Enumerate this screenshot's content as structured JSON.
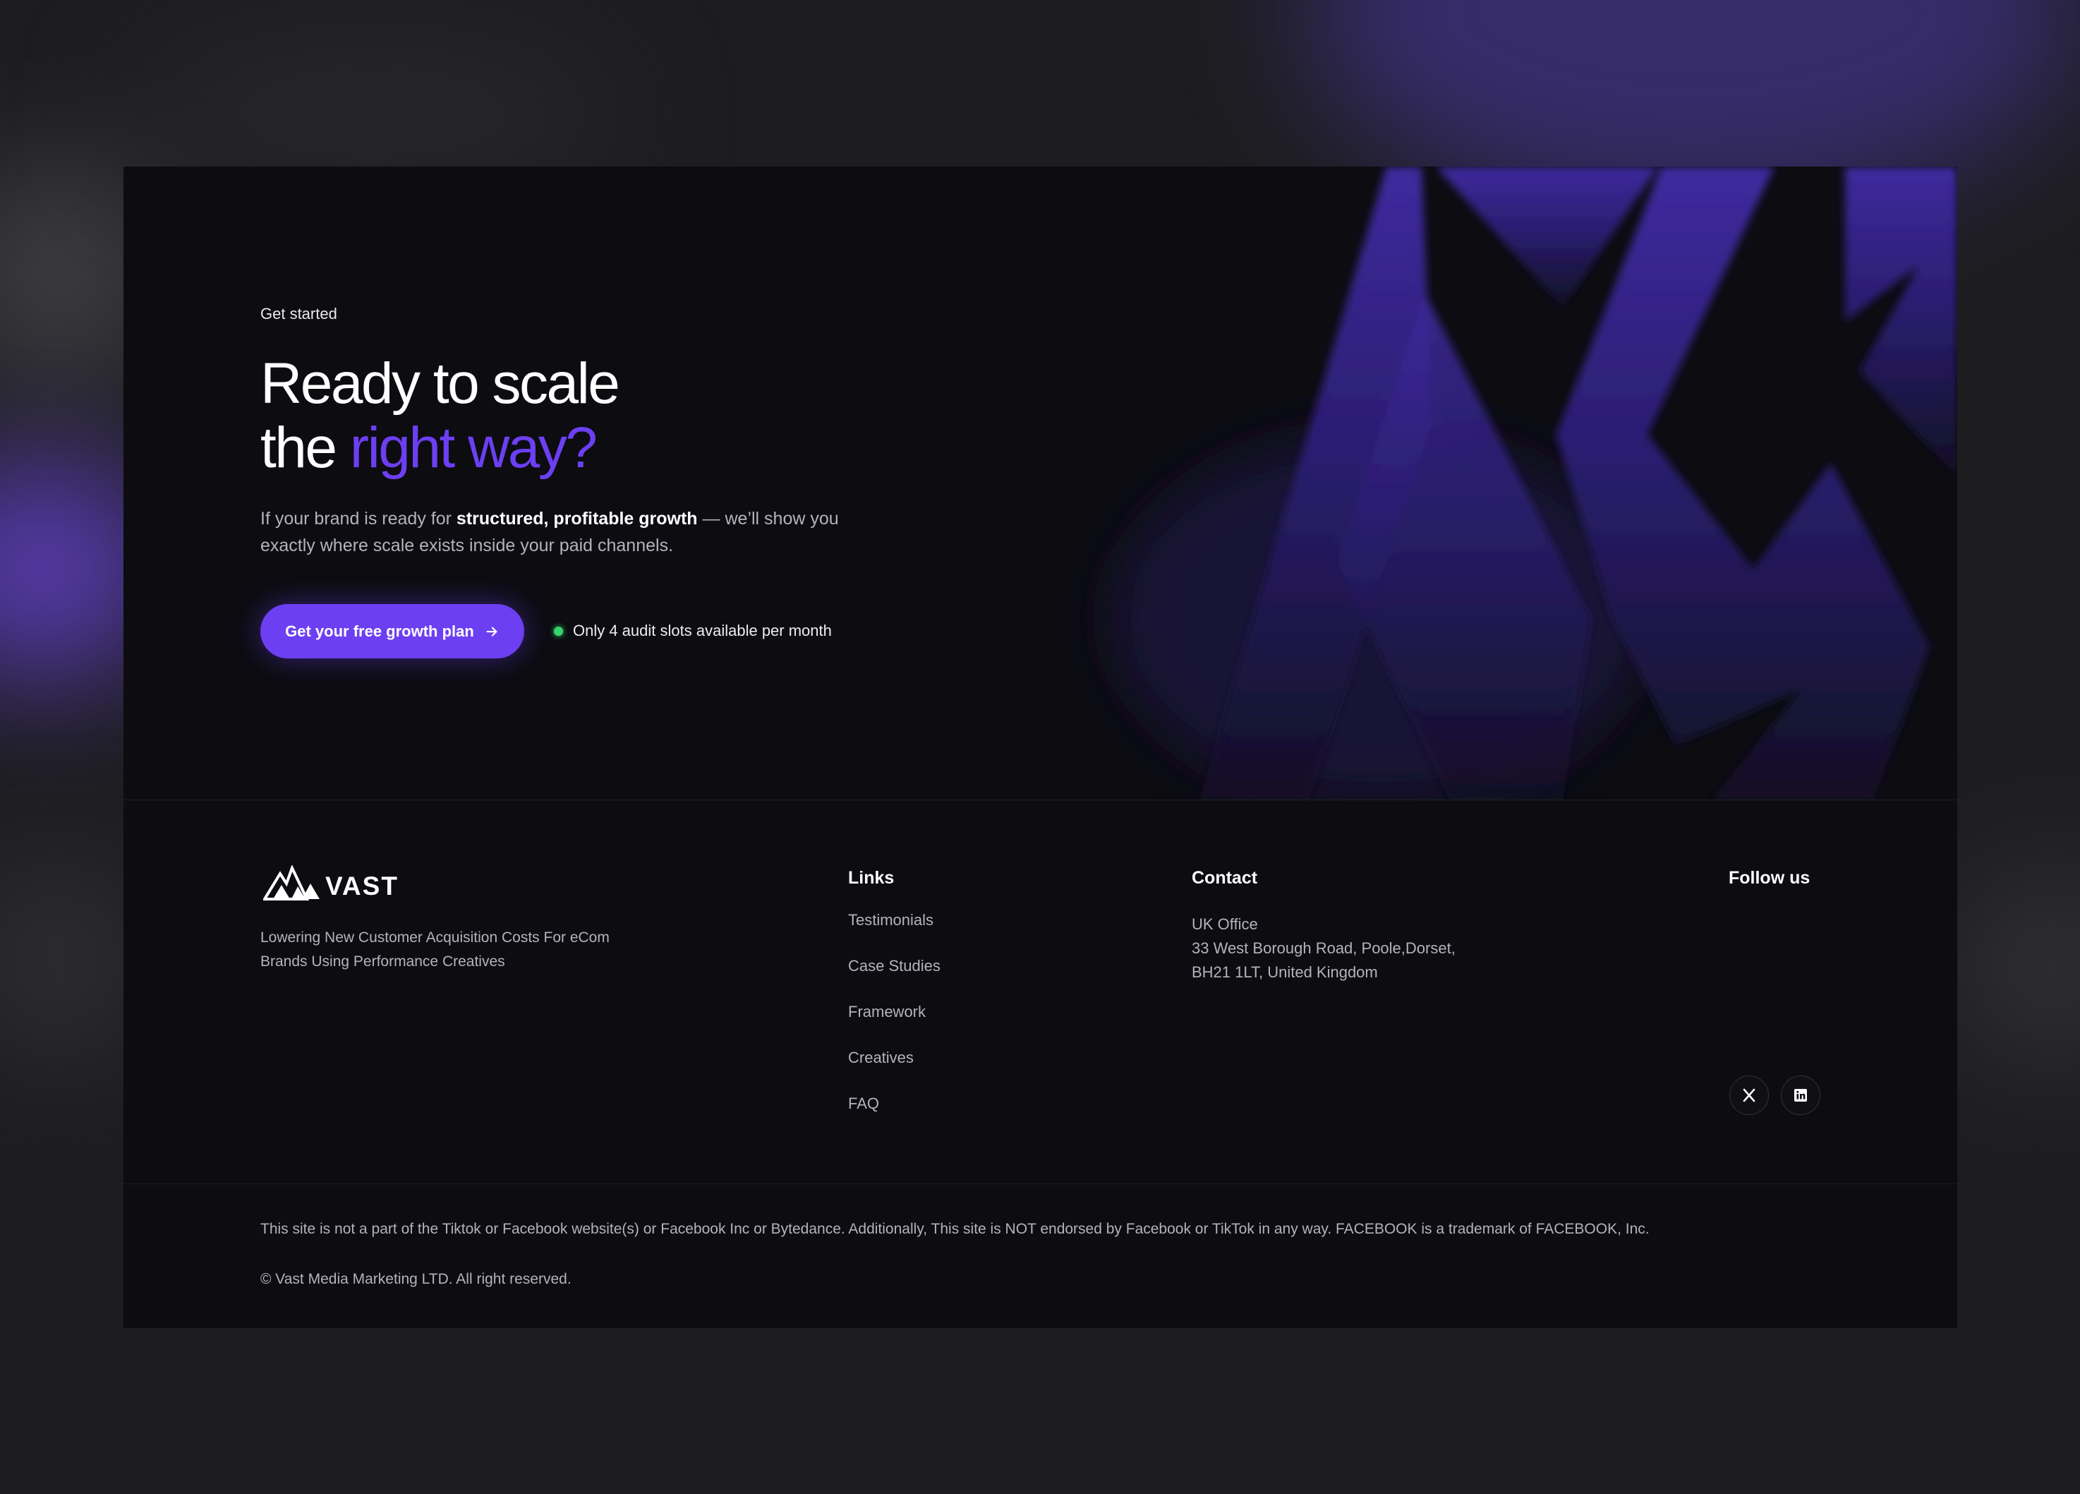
{
  "hero": {
    "eyebrow": "Get started",
    "headline_line1": "Ready to scale",
    "headline_line2_prefix": "the ",
    "headline_line2_accent": "right way?",
    "subtext_before": "If your brand is ready for ",
    "subtext_bold": "structured, profitable growth",
    "subtext_after": " — we’ll show you exactly where scale exists inside your paid channels.",
    "cta_label": "Get your free growth plan",
    "notice": "Only 4 audit slots available per month"
  },
  "footer": {
    "brand_name": "VAST",
    "tagline": "Lowering New Customer Acquisition Costs For eCom Brands Using Performance Creatives",
    "links_title": "Links",
    "links": [
      "Testimonials",
      "Case Studies",
      "Framework",
      "Creatives",
      "FAQ"
    ],
    "contact_title": "Contact",
    "address_line1": "UK Office",
    "address_line2": "33 West Borough Road, Poole,Dorset,",
    "address_line3": "BH21 1LT, United Kingdom",
    "follow_title": "Follow us",
    "socials": [
      "x-icon",
      "linkedin-icon"
    ]
  },
  "legal": {
    "disclaimer": "This site is not a part of the Tiktok or Facebook website(s) or Facebook Inc or Bytedance. Additionally, This site is NOT endorsed by Facebook or TikTok in any way. FACEBOOK is a trademark of FACEBOOK, Inc.",
    "copyright": "© Vast Media Marketing LTD. All right reserved."
  },
  "colors": {
    "accent": "#6c3ff2",
    "background": "#0c0c11",
    "status_dot": "#37d46b"
  }
}
